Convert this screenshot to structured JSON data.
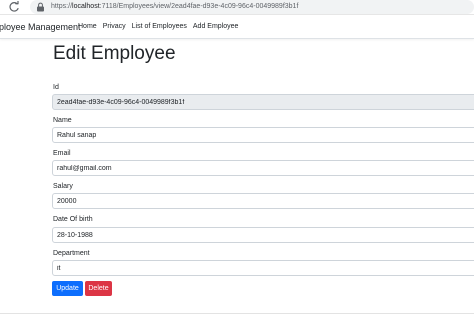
{
  "browser": {
    "url_prefix": "https://",
    "url_host": "localhost",
    "url_rest": ":7118/Employees/view/2ead4fae-d93e-4c09-96c4-0049989f3b1f"
  },
  "navbar": {
    "brand": "ployee Management",
    "links": [
      "Home",
      "Privacy",
      "List of Employees",
      "Add Employee"
    ]
  },
  "page": {
    "title": "Edit Employee"
  },
  "form": {
    "id": {
      "label": "Id",
      "value": "2ead4fae-d93e-4c09-96c4-0049989f3b1f"
    },
    "name": {
      "label": "Name",
      "value": "Rahul sanap"
    },
    "email": {
      "label": "Email",
      "value": "rahul@gmail.com"
    },
    "salary": {
      "label": "Salary",
      "value": "20000"
    },
    "dob": {
      "label": "Date Of birth",
      "value": "28-10-1988"
    },
    "department": {
      "label": "Department",
      "value": "it"
    }
  },
  "actions": {
    "update_label": "Update",
    "delete_label": "Delete"
  },
  "colors": {
    "primary": "#0d6efd",
    "danger": "#dc3545",
    "readonly_bg": "#e9ecef"
  }
}
